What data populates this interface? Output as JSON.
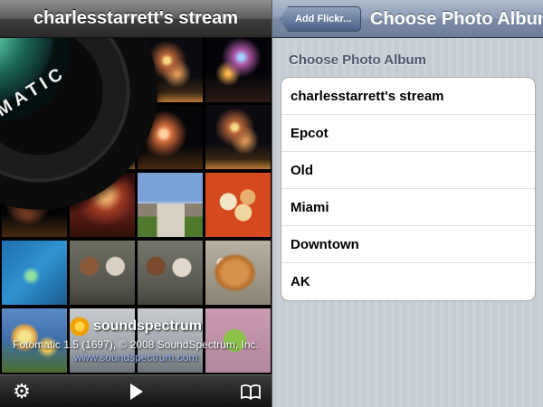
{
  "stream": {
    "title": "charlesstarrett's stream",
    "lens_text": "FOTOMATIC",
    "splash": {
      "logo_text": "soundspectrum",
      "copyright": "Fotomatic 1.5 (1697), © 2008 SoundSpectrum, Inc.",
      "url": "www.soundspectrum.com"
    },
    "toolbar": {
      "settings_icon": "gear-icon",
      "play_icon": "play-icon",
      "bookmarks_icon": "book-icon"
    }
  },
  "album_picker": {
    "back_button": "Add Flickr...",
    "title": "Choose Photo Album",
    "section_header": "Choose Photo Album",
    "albums": [
      "charlesstarrett's stream",
      "Epcot",
      "Old",
      "Miami",
      "Downtown",
      "AK"
    ]
  }
}
